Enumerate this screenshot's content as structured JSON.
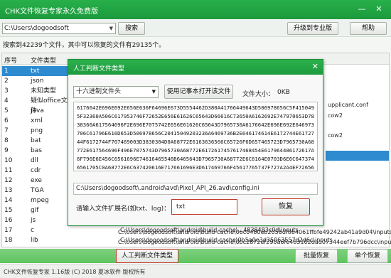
{
  "window": {
    "title": "CHK文件恢复专家永久免费版"
  },
  "toolbar": {
    "path_value": "C:\\Users\\dogoodsoft",
    "search_label": "搜索",
    "upgrade_label": "升级到专业版",
    "help_label": "帮助"
  },
  "info_text": "搜索到42239个文件，其中可以恢复的文件有29135个。",
  "list": {
    "col_num": "序号",
    "col_type": "文件类型",
    "rows": [
      {
        "num": "1",
        "type": "txt"
      },
      {
        "num": "2",
        "type": "json"
      },
      {
        "num": "3",
        "type": "未知类型"
      },
      {
        "num": "4",
        "type": "疑似office文件"
      },
      {
        "num": "5",
        "type": "java"
      },
      {
        "num": "6",
        "type": "xml"
      },
      {
        "num": "7",
        "type": "png"
      },
      {
        "num": "8",
        "type": "bat"
      },
      {
        "num": "9",
        "type": "bas"
      },
      {
        "num": "10",
        "type": "dll"
      },
      {
        "num": "11",
        "type": "cdr"
      },
      {
        "num": "12",
        "type": "exe"
      },
      {
        "num": "13",
        "type": "TGA"
      },
      {
        "num": "14",
        "type": "mpeg"
      },
      {
        "num": "15",
        "type": "gif"
      },
      {
        "num": "16",
        "type": "js"
      },
      {
        "num": "17",
        "type": "c"
      },
      {
        "num": "18",
        "type": "lib"
      },
      {
        "num": "19",
        "type": ""
      }
    ],
    "right_snips": [
      "upplicant.conf",
      "cow2",
      "cow2"
    ],
    "paths": [
      "C:\\Users\\dogoodsoft\\android\\build-cache\\...4838483c0d\\inputs",
      "C:\\Users\\dogoodsoft\\android\\build-cache\\0b5a0e3d35063557d2d6c\\inputs",
      "C:\\Users\\dogoodsoft\\android\\build-cache\\06c0480eb2056df884061ffbfe49242ab41a9d04\\inputs",
      "C:\\Users\\dogoodsoft\\android\\build-cache\\0bc2872ef290a6fe483102dad07344eef7b796dcc\\inputs"
    ]
  },
  "bottom": {
    "manual_label": "人工判断文件类型",
    "batch_label": "批量恢复",
    "single_label": "单个恢复"
  },
  "status": {
    "text": "CHK文件恢复专家  1.16版  (C) 2018 夏冰软件 版权所有"
  },
  "dialog": {
    "title": "人工判断文件类型",
    "combo_value": "十六进制文件头",
    "notepad_label": "使用记事本打开该文件",
    "size_label": "文件大小：",
    "size_value": "0KB",
    "hex": "6176642E696E692E656E636F64696E673D5554462D380A41766449643D506978656C5F4150495F32360A506C617953746F72652E656E61626C65643D66616C73650A6162692E747970653D7838360A617564696F2E696E7075742E656E61626C65643D7965730A6176642E696E692E656E636F64696E673D5554462D380A6176642E696E692E646973706C61796E616D653D506978656C20415049203236A68736...",
    "hex_text": "6176642E696E692E656E636F64696E673D5554462D380A41766449643D506978656C5F4150495F32360A506C617953746F72652E656E61626C65643D66616C73650A6162692E747970653D7838360A617564696F2E696E7075742E656E61626C65643D7965730A6176642E696E692E646973706C61796E616D653D506978656C20415049203236A6469736B2E646174614E6172744E6172744F6172744F707469003D3830304D0A68772E6163636566C65726F6D657465723D7965730A68772E617564696F496E7075743D7965730A68772E6172617457617468454E617964486172617A6F796E6E456C6561696E74616465546B6465643D7965730A68772E6C6164E0703D6E6C6473746561705C0A68772E6C637420616E717661696E3D617469766F45617765737F727A2A4EF72656F7373693D7965730A68772E6C6163636574646F7461747574673D796573",
    "path_value": "C:\\Users\\dogoodsoft\\.android\\avd\\Pixel_API_26.avd\\config.ini",
    "ext_label": "请输入文件扩展名(如txt、log)：",
    "ext_value": "txt",
    "recover_label": "恢复"
  }
}
